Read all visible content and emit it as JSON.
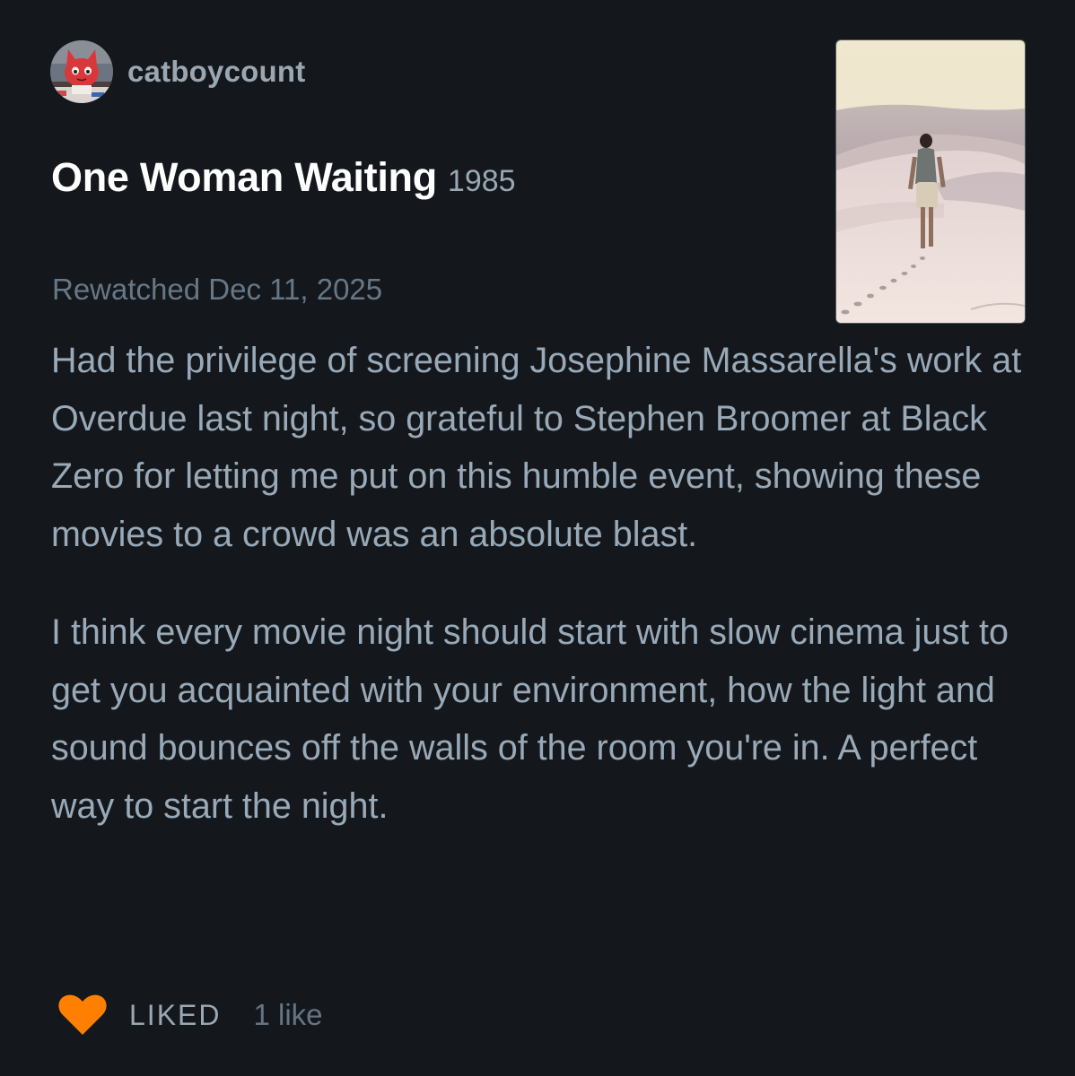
{
  "review": {
    "author": {
      "username": "catboycount"
    },
    "film": {
      "title": "One Woman Waiting",
      "year": "1985"
    },
    "watch_status": "Rewatched Dec 11, 2025",
    "paragraphs": [
      "Had the privilege of screening Josephine Massarella's work at Overdue last night, so grateful to Stephen Broomer at Black Zero for letting me put on this humble event, showing these movies to a crowd was an absolute blast.",
      "I think every movie night should start with slow cinema just to get you acquainted with your environment, how the light and sound bounces off the walls of the room you're in. A perfect way to start the night."
    ],
    "actions": {
      "heart_icon": "heart-icon",
      "liked_label": "LIKED",
      "like_count": "1 like"
    }
  },
  "colors": {
    "background": "#14181c",
    "title": "#ffffff",
    "body_text": "#99a9b8",
    "muted": "#687786",
    "like_accent": "#ff8000"
  }
}
